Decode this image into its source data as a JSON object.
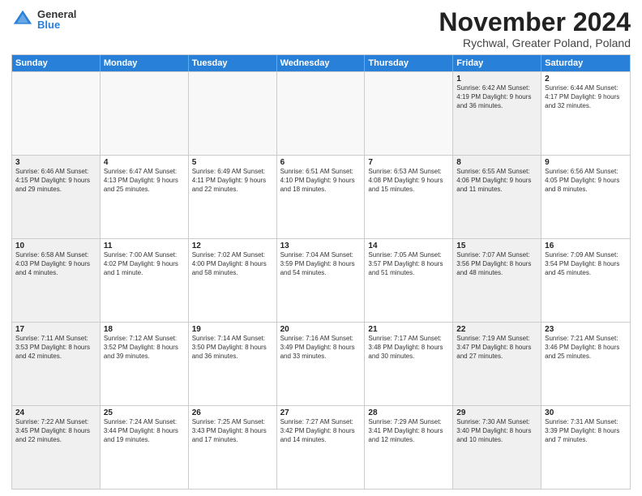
{
  "header": {
    "logo_general": "General",
    "logo_blue": "Blue",
    "title": "November 2024",
    "location": "Rychwal, Greater Poland, Poland"
  },
  "days_of_week": [
    "Sunday",
    "Monday",
    "Tuesday",
    "Wednesday",
    "Thursday",
    "Friday",
    "Saturday"
  ],
  "rows": [
    [
      {
        "day": "",
        "detail": "",
        "empty": true
      },
      {
        "day": "",
        "detail": "",
        "empty": true
      },
      {
        "day": "",
        "detail": "",
        "empty": true
      },
      {
        "day": "",
        "detail": "",
        "empty": true
      },
      {
        "day": "",
        "detail": "",
        "empty": true
      },
      {
        "day": "1",
        "detail": "Sunrise: 6:42 AM\nSunset: 4:19 PM\nDaylight: 9 hours\nand 36 minutes.",
        "shaded": true
      },
      {
        "day": "2",
        "detail": "Sunrise: 6:44 AM\nSunset: 4:17 PM\nDaylight: 9 hours\nand 32 minutes.",
        "shaded": false
      }
    ],
    [
      {
        "day": "3",
        "detail": "Sunrise: 6:46 AM\nSunset: 4:15 PM\nDaylight: 9 hours\nand 29 minutes.",
        "shaded": true
      },
      {
        "day": "4",
        "detail": "Sunrise: 6:47 AM\nSunset: 4:13 PM\nDaylight: 9 hours\nand 25 minutes.",
        "shaded": false
      },
      {
        "day": "5",
        "detail": "Sunrise: 6:49 AM\nSunset: 4:11 PM\nDaylight: 9 hours\nand 22 minutes.",
        "shaded": false
      },
      {
        "day": "6",
        "detail": "Sunrise: 6:51 AM\nSunset: 4:10 PM\nDaylight: 9 hours\nand 18 minutes.",
        "shaded": false
      },
      {
        "day": "7",
        "detail": "Sunrise: 6:53 AM\nSunset: 4:08 PM\nDaylight: 9 hours\nand 15 minutes.",
        "shaded": false
      },
      {
        "day": "8",
        "detail": "Sunrise: 6:55 AM\nSunset: 4:06 PM\nDaylight: 9 hours\nand 11 minutes.",
        "shaded": true
      },
      {
        "day": "9",
        "detail": "Sunrise: 6:56 AM\nSunset: 4:05 PM\nDaylight: 9 hours\nand 8 minutes.",
        "shaded": false
      }
    ],
    [
      {
        "day": "10",
        "detail": "Sunrise: 6:58 AM\nSunset: 4:03 PM\nDaylight: 9 hours\nand 4 minutes.",
        "shaded": true
      },
      {
        "day": "11",
        "detail": "Sunrise: 7:00 AM\nSunset: 4:02 PM\nDaylight: 9 hours\nand 1 minute.",
        "shaded": false
      },
      {
        "day": "12",
        "detail": "Sunrise: 7:02 AM\nSunset: 4:00 PM\nDaylight: 8 hours\nand 58 minutes.",
        "shaded": false
      },
      {
        "day": "13",
        "detail": "Sunrise: 7:04 AM\nSunset: 3:59 PM\nDaylight: 8 hours\nand 54 minutes.",
        "shaded": false
      },
      {
        "day": "14",
        "detail": "Sunrise: 7:05 AM\nSunset: 3:57 PM\nDaylight: 8 hours\nand 51 minutes.",
        "shaded": false
      },
      {
        "day": "15",
        "detail": "Sunrise: 7:07 AM\nSunset: 3:56 PM\nDaylight: 8 hours\nand 48 minutes.",
        "shaded": true
      },
      {
        "day": "16",
        "detail": "Sunrise: 7:09 AM\nSunset: 3:54 PM\nDaylight: 8 hours\nand 45 minutes.",
        "shaded": false
      }
    ],
    [
      {
        "day": "17",
        "detail": "Sunrise: 7:11 AM\nSunset: 3:53 PM\nDaylight: 8 hours\nand 42 minutes.",
        "shaded": true
      },
      {
        "day": "18",
        "detail": "Sunrise: 7:12 AM\nSunset: 3:52 PM\nDaylight: 8 hours\nand 39 minutes.",
        "shaded": false
      },
      {
        "day": "19",
        "detail": "Sunrise: 7:14 AM\nSunset: 3:50 PM\nDaylight: 8 hours\nand 36 minutes.",
        "shaded": false
      },
      {
        "day": "20",
        "detail": "Sunrise: 7:16 AM\nSunset: 3:49 PM\nDaylight: 8 hours\nand 33 minutes.",
        "shaded": false
      },
      {
        "day": "21",
        "detail": "Sunrise: 7:17 AM\nSunset: 3:48 PM\nDaylight: 8 hours\nand 30 minutes.",
        "shaded": false
      },
      {
        "day": "22",
        "detail": "Sunrise: 7:19 AM\nSunset: 3:47 PM\nDaylight: 8 hours\nand 27 minutes.",
        "shaded": true
      },
      {
        "day": "23",
        "detail": "Sunrise: 7:21 AM\nSunset: 3:46 PM\nDaylight: 8 hours\nand 25 minutes.",
        "shaded": false
      }
    ],
    [
      {
        "day": "24",
        "detail": "Sunrise: 7:22 AM\nSunset: 3:45 PM\nDaylight: 8 hours\nand 22 minutes.",
        "shaded": true
      },
      {
        "day": "25",
        "detail": "Sunrise: 7:24 AM\nSunset: 3:44 PM\nDaylight: 8 hours\nand 19 minutes.",
        "shaded": false
      },
      {
        "day": "26",
        "detail": "Sunrise: 7:25 AM\nSunset: 3:43 PM\nDaylight: 8 hours\nand 17 minutes.",
        "shaded": false
      },
      {
        "day": "27",
        "detail": "Sunrise: 7:27 AM\nSunset: 3:42 PM\nDaylight: 8 hours\nand 14 minutes.",
        "shaded": false
      },
      {
        "day": "28",
        "detail": "Sunrise: 7:29 AM\nSunset: 3:41 PM\nDaylight: 8 hours\nand 12 minutes.",
        "shaded": false
      },
      {
        "day": "29",
        "detail": "Sunrise: 7:30 AM\nSunset: 3:40 PM\nDaylight: 8 hours\nand 10 minutes.",
        "shaded": true
      },
      {
        "day": "30",
        "detail": "Sunrise: 7:31 AM\nSunset: 3:39 PM\nDaylight: 8 hours\nand 7 minutes.",
        "shaded": false
      }
    ]
  ]
}
